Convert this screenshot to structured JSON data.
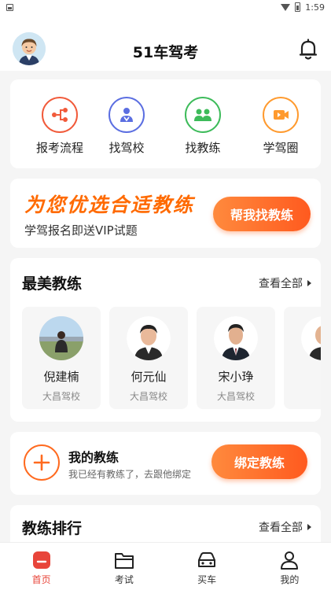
{
  "status_bar": {
    "time": "1:59",
    "app_icon": "app-notification-icon",
    "wifi_icon": "wifi-icon",
    "battery_icon": "battery-icon"
  },
  "header": {
    "title": "51车驾考",
    "avatar_icon": "user-avatar",
    "bell_icon": "bell-icon"
  },
  "quick_entries": [
    {
      "label": "报考流程",
      "icon": "flow-icon",
      "color": "#f15a3a"
    },
    {
      "label": "找驾校",
      "icon": "school-icon",
      "color": "#5b6ee1"
    },
    {
      "label": "找教练",
      "icon": "coach-group-icon",
      "color": "#3dbb5a"
    },
    {
      "label": "学驾圈",
      "icon": "video-icon",
      "color": "#ff9a2e"
    }
  ],
  "banner": {
    "title": "为您优选合适教练",
    "subtitle": "学驾报名即送VIP试题",
    "button": "帮我找教练",
    "accent": "#ff6a00"
  },
  "best_coaches": {
    "title": "最美教练",
    "view_all": "查看全部",
    "items": [
      {
        "name": "倪建楠",
        "school": "大昌驾校"
      },
      {
        "name": "何元仙",
        "school": "大昌驾校"
      },
      {
        "name": "宋小琤",
        "school": "大昌驾校"
      },
      {
        "name": "",
        "school": ""
      }
    ]
  },
  "my_coach": {
    "title": "我的教练",
    "subtitle": "我已经有教练了，去跟他绑定",
    "button": "绑定教练",
    "icon": "plus-circle-icon"
  },
  "ranking": {
    "title": "教练排行",
    "view_all": "查看全部"
  },
  "tabbar": {
    "active": "home",
    "active_color": "#e8453a",
    "items": [
      {
        "key": "home",
        "label": "首页",
        "icon": "home-icon"
      },
      {
        "key": "exam",
        "label": "考试",
        "icon": "folder-icon"
      },
      {
        "key": "car",
        "label": "买车",
        "icon": "car-icon"
      },
      {
        "key": "mine",
        "label": "我的",
        "icon": "person-icon"
      }
    ]
  }
}
